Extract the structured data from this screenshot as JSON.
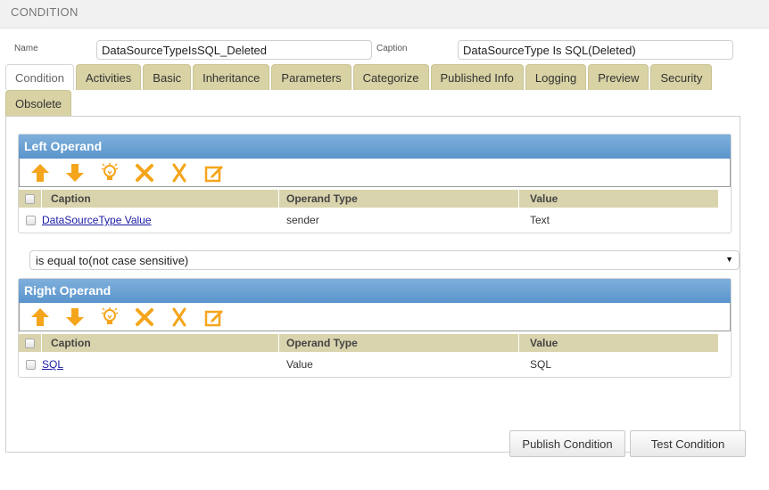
{
  "header": {
    "title": "CONDITION"
  },
  "form": {
    "name_label": "Name",
    "name_value": "DataSourceTypeIsSQL_Deleted",
    "caption_label": "Caption",
    "caption_value": "DataSourceType Is SQL(Deleted)"
  },
  "tabs": [
    {
      "label": "Condition",
      "active": true
    },
    {
      "label": "Activities"
    },
    {
      "label": "Basic"
    },
    {
      "label": "Inheritance"
    },
    {
      "label": "Parameters"
    },
    {
      "label": "Categorize"
    },
    {
      "label": "Published Info"
    },
    {
      "label": "Logging"
    },
    {
      "label": "Preview"
    },
    {
      "label": "Security"
    },
    {
      "label": "Obsolete"
    }
  ],
  "toolbar_icons": [
    "move-up-icon",
    "move-down-icon",
    "lightbulb-icon",
    "delete-icon",
    "split-icon",
    "edit-icon"
  ],
  "columns": {
    "caption": "Caption",
    "operand_type": "Operand Type",
    "value": "Value"
  },
  "left_operand": {
    "title": "Left Operand",
    "rows": [
      {
        "caption": "DataSourceType Value",
        "operand_type": "sender",
        "value": "Text"
      }
    ]
  },
  "operator": {
    "selected": "is equal to(not case sensitive)"
  },
  "right_operand": {
    "title": "Right Operand",
    "rows": [
      {
        "caption": "SQL",
        "operand_type": "Value",
        "value": "SQL"
      }
    ]
  },
  "buttons": {
    "publish": "Publish Condition",
    "test": "Test Condition"
  },
  "colors": {
    "accent_orange": "#f5a51b",
    "header_blue": "#5a95cc",
    "tab_khaki": "#d8d2a4"
  }
}
